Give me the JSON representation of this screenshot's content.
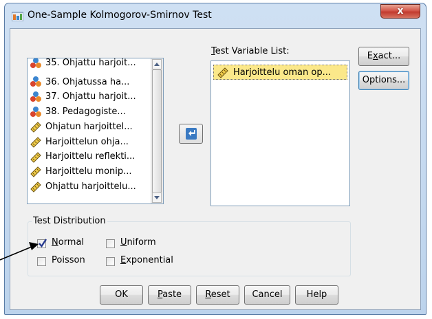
{
  "window": {
    "title": "One-Sample Kolmogorov-Smirnov Test",
    "close_label": "x"
  },
  "source_list": {
    "items": [
      {
        "label": "35. Ohjattu harjoit...",
        "icon": "nominal-icon"
      },
      {
        "label": "36. Ohjatussa ha...",
        "icon": "nominal-icon"
      },
      {
        "label": "37. Ohjattu harjoit...",
        "icon": "nominal-icon"
      },
      {
        "label": "38. Pedagogiste...",
        "icon": "nominal-icon"
      },
      {
        "label": "Ohjatun harjoittel...",
        "icon": "scale-icon"
      },
      {
        "label": "Harjoittelun ohja...",
        "icon": "scale-icon"
      },
      {
        "label": "Harjoittelu reflekti...",
        "icon": "scale-icon"
      },
      {
        "label": "Harjoittelu monip...",
        "icon": "scale-icon"
      },
      {
        "label": "Ohjattu harjoittelu...",
        "icon": "scale-icon"
      }
    ]
  },
  "target": {
    "label_mnemonic": "T",
    "label_rest": "est Variable List:",
    "items": [
      {
        "label": "Harjoittelu oman op...",
        "icon": "scale-icon"
      }
    ]
  },
  "buttons": {
    "exact_pre": "E",
    "exact_mn": "x",
    "exact_post": "act...",
    "options_label": "Options...",
    "ok": "OK",
    "paste_mn": "P",
    "paste_rest": "aste",
    "reset_mn": "R",
    "reset_rest": "eset",
    "cancel": "Cancel",
    "help": "Help"
  },
  "distribution": {
    "legend": "Test Distribution",
    "options": [
      {
        "mn": "N",
        "rest": "ormal",
        "checked": true
      },
      {
        "mn": "U",
        "rest": "niform",
        "checked": false
      },
      {
        "mn": "",
        "rest": "Poisson",
        "checked": false
      },
      {
        "mn": "E",
        "rest": "xponential",
        "checked": false
      }
    ]
  },
  "colors": {
    "selection": "#fbe88a",
    "move_arrow": "#3a7ac2",
    "close_button": "#c9463a"
  }
}
